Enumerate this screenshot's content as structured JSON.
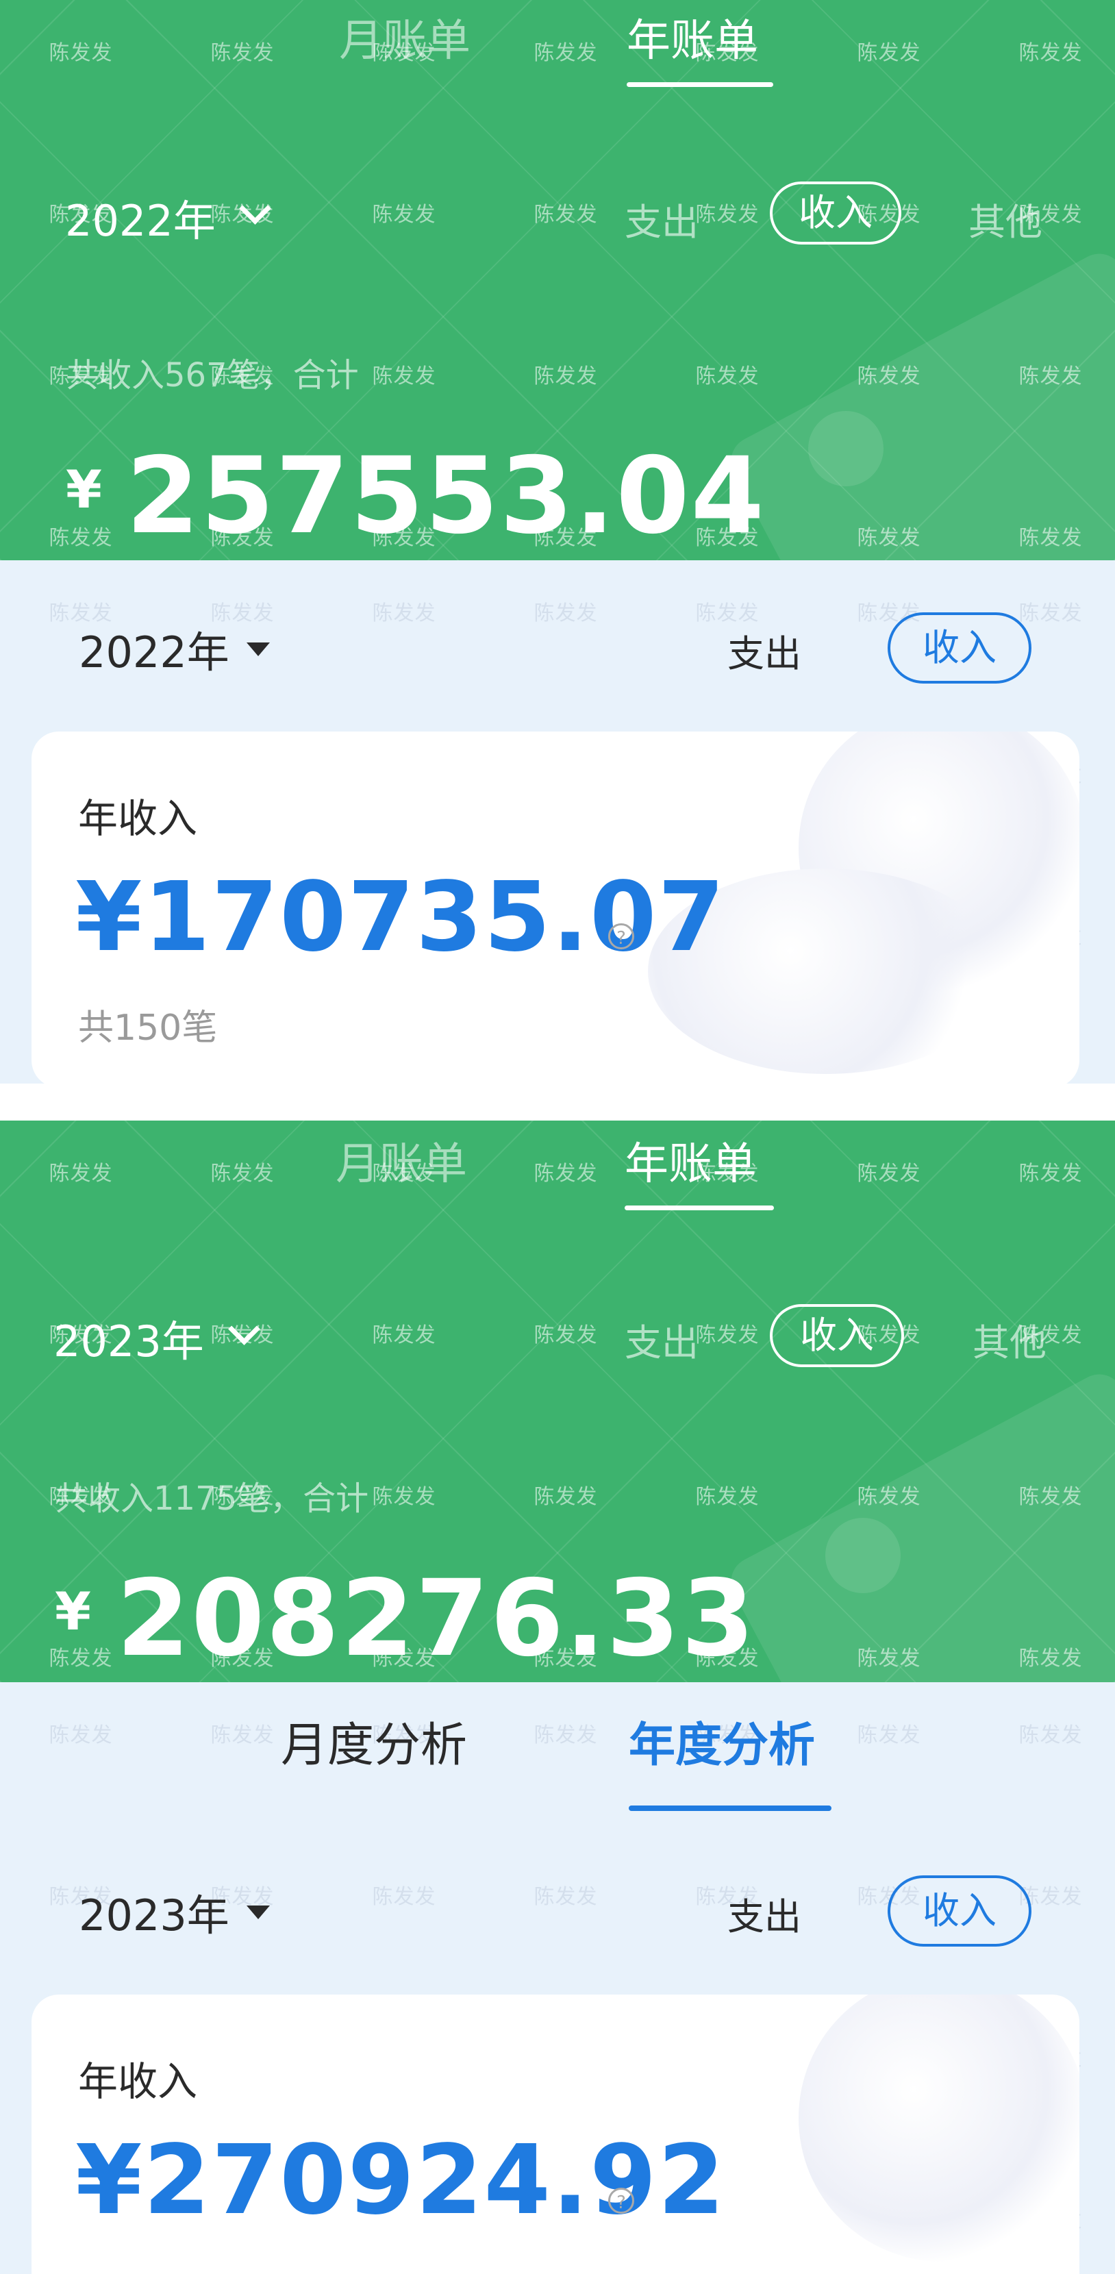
{
  "panel1": {
    "tabs": [
      "月账单",
      "年账单"
    ],
    "active_tab": "年账单",
    "year": "2022年",
    "segments": [
      "支出",
      "收入",
      "其他"
    ],
    "active_segment": "收入",
    "summary": "共收入567笔，合计",
    "currency": "¥",
    "amount": "257553.04"
  },
  "panel2": {
    "year": "2022年",
    "seg_expense": "支出",
    "seg_income": "收入",
    "card_title": "年收入",
    "amount": "¥170735.07",
    "help": "?",
    "count": "共150笔"
  },
  "panel3": {
    "tabs": [
      "月账单",
      "年账单"
    ],
    "active_tab": "年账单",
    "year": "2023年",
    "segments": [
      "支出",
      "收入",
      "其他"
    ],
    "active_segment": "收入",
    "summary": "共收入1175笔，合计",
    "currency": "¥",
    "amount": "208276.33"
  },
  "panel4": {
    "analysis_tabs": [
      "月度分析",
      "年度分析"
    ],
    "active_analysis_tab": "年度分析",
    "year": "2023年",
    "seg_expense": "支出",
    "seg_income": "收入",
    "card_title": "年收入",
    "amount": "¥270924.92",
    "help": "?"
  },
  "watermark": "陈发发",
  "colors": {
    "green": "#3db36e",
    "accent_blue": "#1f7be0",
    "light_blue_bg": "#e8f2fb"
  }
}
